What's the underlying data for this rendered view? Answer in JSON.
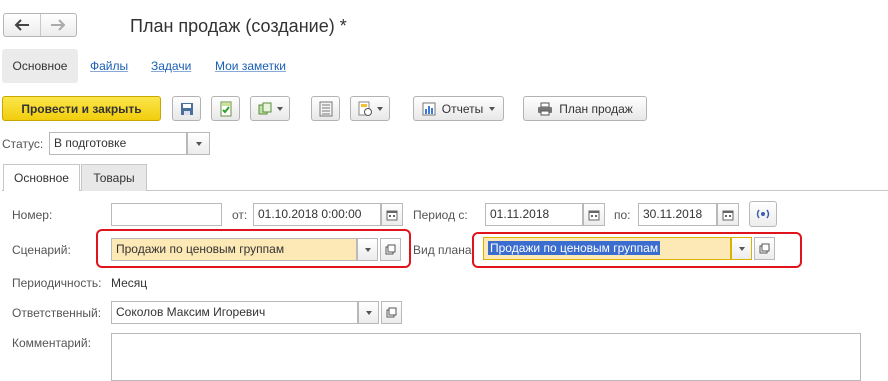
{
  "window": {
    "title": "План продаж (создание) *"
  },
  "section_tabs": {
    "main": "Основное",
    "files": "Файлы",
    "tasks": "Задачи",
    "notes": "Мои заметки"
  },
  "toolbar": {
    "post_close": "Провести и закрыть",
    "reports": "Отчеты",
    "sales_plan": "План продаж"
  },
  "status": {
    "label": "Статус:",
    "value": "В подготовке"
  },
  "tabs": {
    "main": "Основное",
    "goods": "Товары"
  },
  "form": {
    "number_label": "Номер:",
    "number_value": "",
    "from_label": "от:",
    "from_value": "01.10.2018  0:00:00",
    "period_label": "Период с:",
    "period_from": "01.11.2018",
    "period_to_label": "по:",
    "period_to": "30.11.2018",
    "scenario_label": "Сценарий:",
    "scenario_value": "Продажи по ценовым группам",
    "plan_type_label": "Вид плана:",
    "plan_type_value": "Продажи по ценовым группам",
    "periodicity_label": "Периодичность:",
    "periodicity_value": "Месяц",
    "responsible_label": "Ответственный:",
    "responsible_value": "Соколов Максим Игоревич",
    "comment_label": "Комментарий:",
    "comment_value": ""
  },
  "colors": {
    "accent_yellow": "#f5d515",
    "highlight_red": "#e0141c",
    "link_blue": "#1a5fb4",
    "field_yellow": "#fde9b6"
  }
}
